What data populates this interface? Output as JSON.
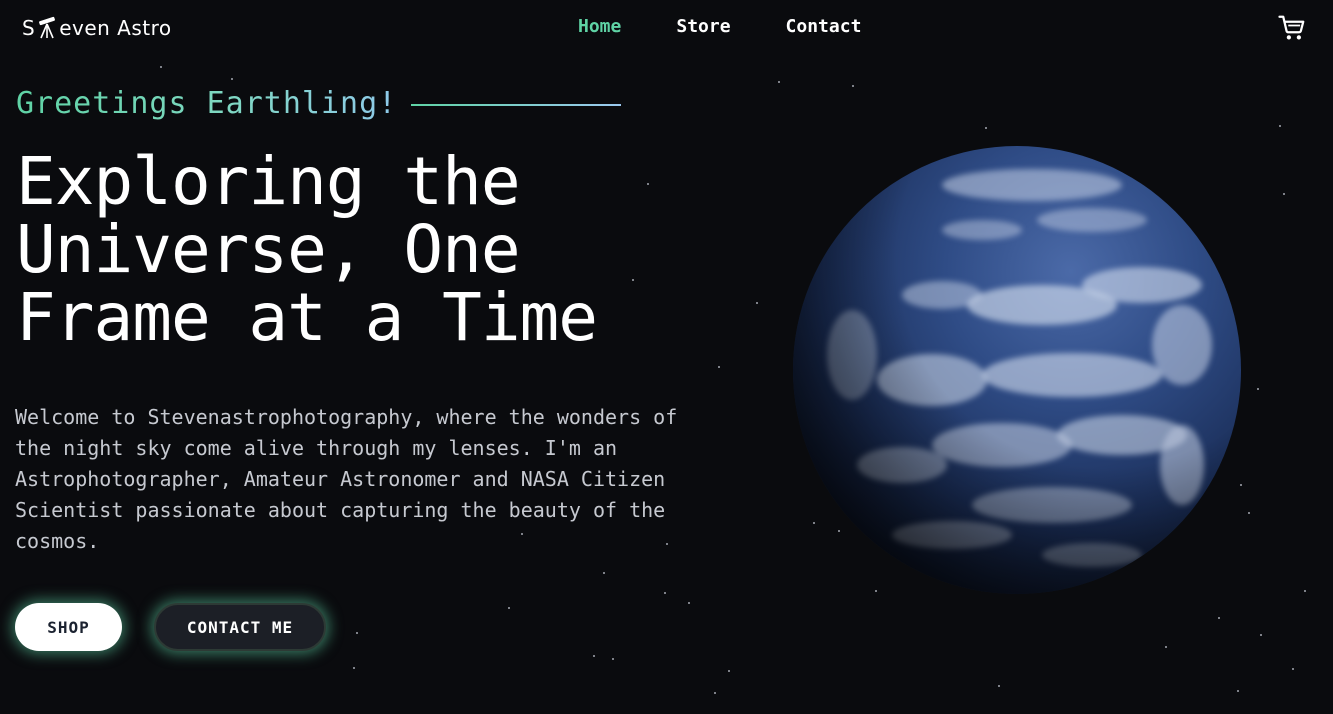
{
  "header": {
    "logo_text_before": "S",
    "logo_text_after": "even Astro",
    "nav": {
      "home": "Home",
      "store": "Store",
      "contact": "Contact"
    },
    "cart_icon": "shopping-cart-icon"
  },
  "hero": {
    "greeting": "Greetings Earthling!",
    "headline_line1": "Exploring the",
    "headline_line2": "Universe, One",
    "headline_line3": "Frame at a Time",
    "intro": "Welcome to Stevenastrophotography, where the wonders of the night sky come alive through my lenses. I'm an Astrophotographer, Amateur Astronomer and NASA Citizen Scientist passionate about capturing the beauty of the cosmos.",
    "shop_label": "SHOP",
    "contact_label": "CONTACT ME"
  },
  "colors": {
    "background": "#0a0b0e",
    "accent": "#5fd3a5",
    "accent_blue": "#8fc9ea",
    "text": "#ffffff",
    "body_text": "#c6c9d0"
  }
}
